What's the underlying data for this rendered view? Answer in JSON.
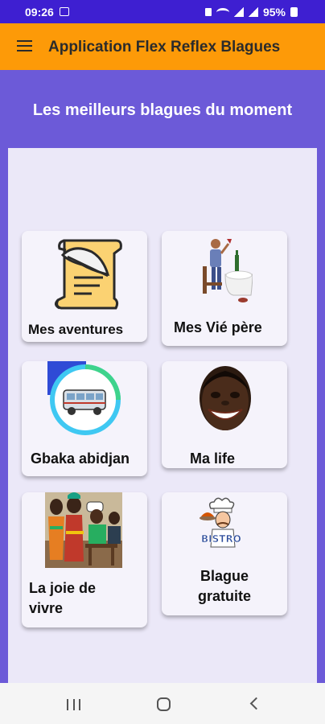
{
  "status": {
    "time": "09:26",
    "battery": "95%"
  },
  "appbar": {
    "title": "Application Flex Reflex Blagues",
    "menu_icon": "menu-icon"
  },
  "hero": {
    "heading": "Les meilleurs blagues du moment"
  },
  "categories": [
    {
      "label": "Mes aventures",
      "icon": "scroll-quill-icon"
    },
    {
      "label": "Mes Vié père",
      "icon": "old-man-dining-icon"
    },
    {
      "label": "Gbaka abidjan",
      "icon": "minibus-icon"
    },
    {
      "label": "Ma life",
      "icon": "smiling-man-icon"
    },
    {
      "label": "La joie de vivre",
      "icon": "family-scene-icon"
    },
    {
      "label": "Blague gratuite",
      "icon": "bistro-chef-icon"
    }
  ],
  "colors": {
    "statusbar": "#3e1fd1",
    "appbar": "#fd9a08",
    "hero": "#6c5ad8",
    "panel": "#ebe8f8"
  },
  "navbar": {
    "icons": [
      "recent-apps-icon",
      "home-icon",
      "back-icon"
    ]
  }
}
